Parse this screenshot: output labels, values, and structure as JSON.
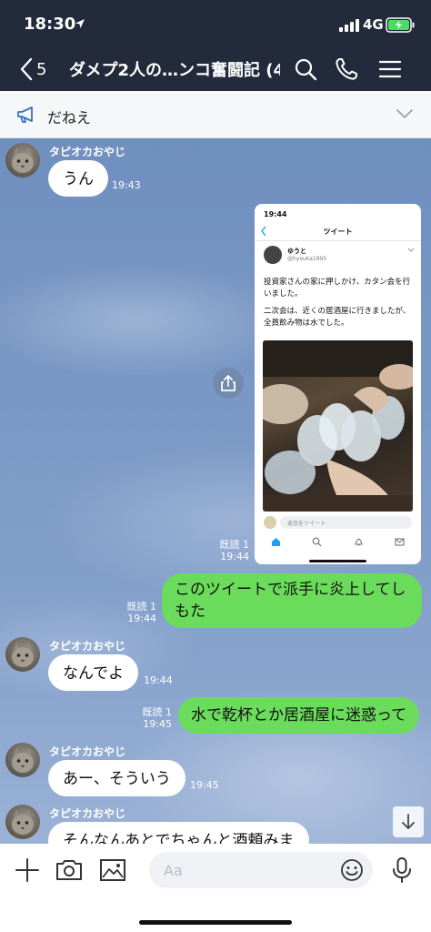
{
  "status_bar": {
    "time": "18:30",
    "network": "4G"
  },
  "header": {
    "back_count": "5",
    "title": "ダメプ2人の…ンコ奮闘記 (4)"
  },
  "announcement": {
    "text": "だねえ"
  },
  "messages": [
    {
      "sender": "タピオカおやじ",
      "text": "うん",
      "time": "19:43"
    },
    {
      "read": "既読 1",
      "time": "19:44"
    },
    {
      "text": "このツイートで派手に炎上してしもた",
      "line1": "このツイートで派手に炎上してし",
      "line2": "もた",
      "read": "既読 1",
      "time": "19:44"
    },
    {
      "sender": "タピオカおやじ",
      "text": "なんでよ",
      "time": "19:44"
    },
    {
      "text": "水で乾杯とか居酒屋に迷惑って",
      "read": "既読 1",
      "time": "19:45"
    },
    {
      "sender": "タピオカおやじ",
      "text": "あー、そういう",
      "time": "19:45"
    },
    {
      "sender": "タピオカおやじ",
      "text": "そんなんあとでちゃんと酒頼みま"
    }
  ],
  "tweet_screenshot": {
    "time": "19:44",
    "title": "ツイート",
    "user_name": "ゆうと",
    "user_handle": "@hyouka1995",
    "text_line1": "投資家さんの家に押しかけ、カタン会を行いました。",
    "text_line2": "二次会は、近くの居酒屋に行きましたが、全員飲み物は水でした。",
    "reply_placeholder": "返信をツイート"
  },
  "input": {
    "placeholder": "Aa"
  },
  "colors": {
    "header_bg": "#222a3b",
    "outgoing_bubble": "#6bdb5b",
    "incoming_bubble": "#ffffff",
    "chat_bg": "#7b99c6"
  },
  "icons": {
    "header": [
      "back-chevron-icon",
      "search-icon",
      "phone-icon",
      "menu-icon"
    ],
    "input_bar": [
      "plus-icon",
      "camera-icon",
      "image-icon",
      "emoji-icon",
      "microphone-icon"
    ],
    "chat": [
      "share-icon",
      "scroll-down-icon"
    ]
  }
}
